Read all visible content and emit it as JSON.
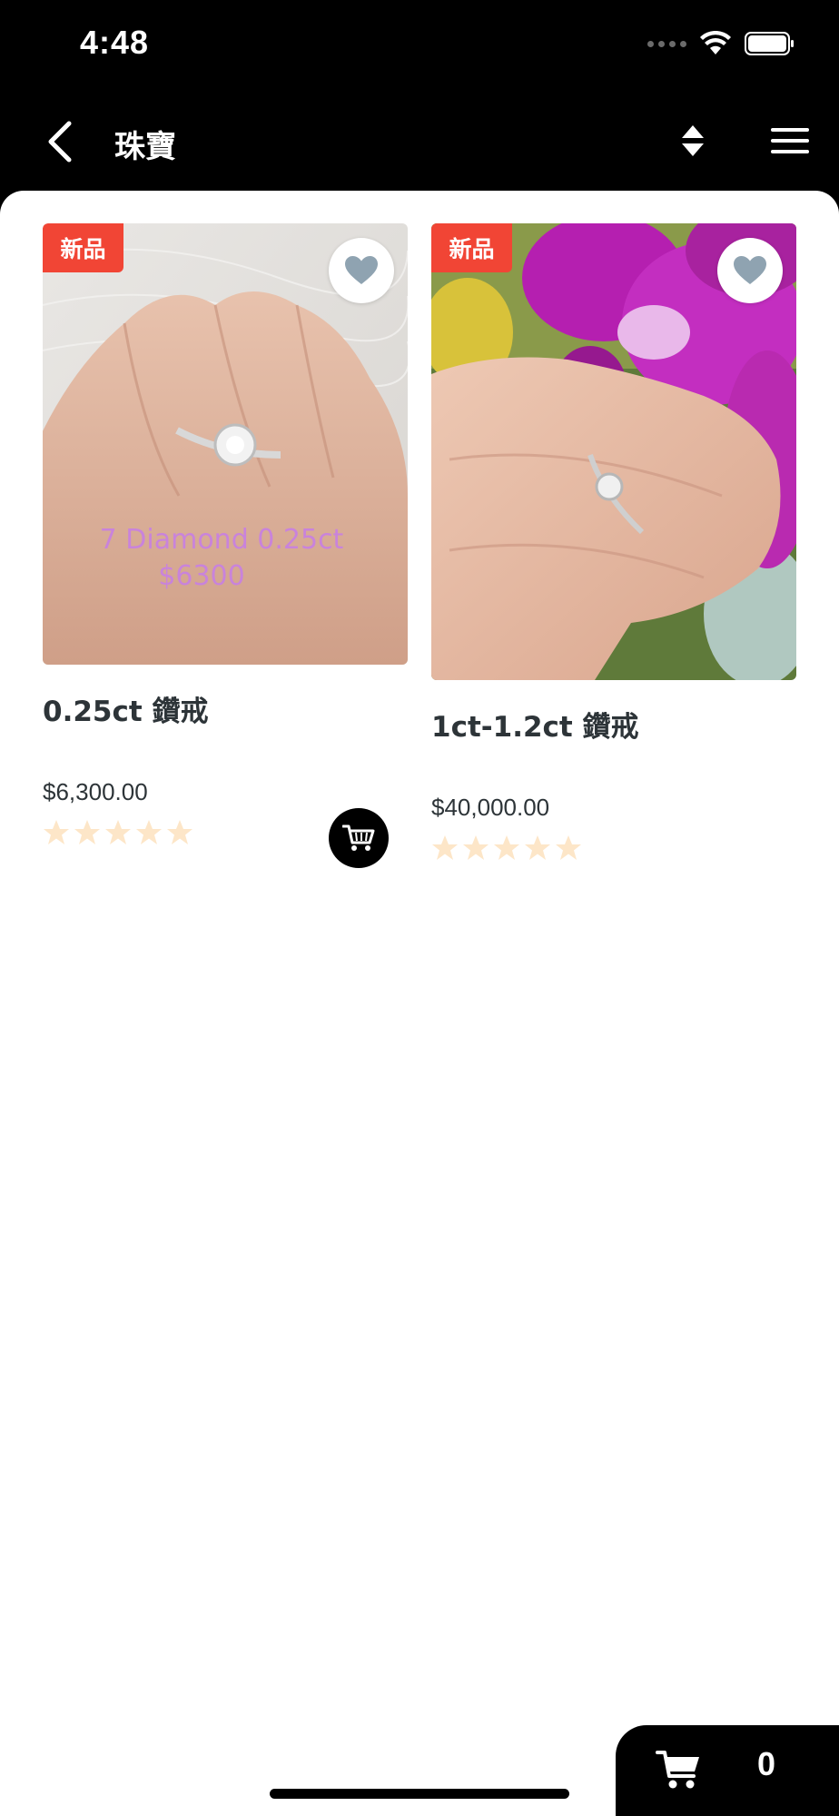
{
  "status_bar": {
    "time": "4:48"
  },
  "nav": {
    "title": "珠寶"
  },
  "products": [
    {
      "badge": "新品",
      "name": "0.25ct 鑽戒",
      "price": "$6,300.00",
      "image_overlay_line1": "7 Diamond 0.25ct",
      "image_overlay_line2": "$6300",
      "rating": 0
    },
    {
      "badge": "新品",
      "name": "1ct-1.2ct 鑽戒",
      "price": "$40,000.00",
      "rating": 0
    }
  ],
  "cart": {
    "count": "0"
  },
  "colors": {
    "badge": "#f14535",
    "heart": "#8fa3b1",
    "star_empty": "#fde6c8"
  }
}
